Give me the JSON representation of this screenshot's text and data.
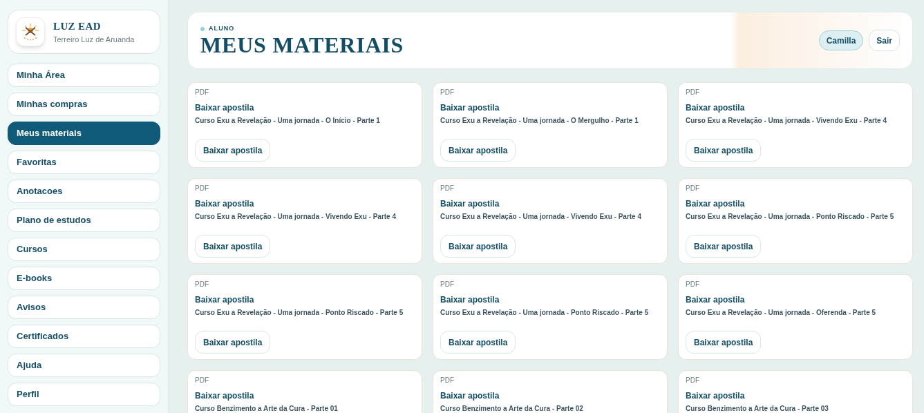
{
  "brand": {
    "title": "LUZ EAD",
    "subtitle": "Terreiro Luz de Aruanda"
  },
  "sidebar": {
    "items": [
      {
        "label": "Minha Área",
        "selected": false
      },
      {
        "label": "Minhas compras",
        "selected": false
      },
      {
        "label": "Meus materiais",
        "selected": true
      },
      {
        "label": "Favoritas",
        "selected": false
      },
      {
        "label": "Anotacoes",
        "selected": false
      },
      {
        "label": "Plano de estudos",
        "selected": false
      },
      {
        "label": "Cursos",
        "selected": false
      },
      {
        "label": "E-books",
        "selected": false
      },
      {
        "label": "Avisos",
        "selected": false
      },
      {
        "label": "Certificados",
        "selected": false
      },
      {
        "label": "Ajuda",
        "selected": false
      },
      {
        "label": "Perfil",
        "selected": false
      }
    ]
  },
  "header": {
    "eyebrow": "ALUNO",
    "title": "MEUS MATERIAIS",
    "user_button": "Camilla",
    "logout_button": "Sair"
  },
  "materials": [
    {
      "type": "PDF",
      "title": "Baixar apostila",
      "course": "Curso Exu a Revelação - Uma jornada - O Início - Parte 1",
      "button": "Baixar apostila"
    },
    {
      "type": "PDF",
      "title": "Baixar apostila",
      "course": "Curso Exu a Revelação - Uma jornada - O Mergulho - Parte 1",
      "button": "Baixar apostila"
    },
    {
      "type": "PDF",
      "title": "Baixar apostila",
      "course": "Curso Exu a Revelação - Uma jornada - Vivendo Exu - Parte 4",
      "button": "Baixar apostila"
    },
    {
      "type": "PDF",
      "title": "Baixar apostila",
      "course": "Curso Exu a Revelação - Uma jornada - Vivendo Exu - Parte 4",
      "button": "Baixar apostila"
    },
    {
      "type": "PDF",
      "title": "Baixar apostila",
      "course": "Curso Exu a Revelação - Uma jornada - Vivendo Exu - Parte 4",
      "button": "Baixar apostila"
    },
    {
      "type": "PDF",
      "title": "Baixar apostila",
      "course": "Curso Exu a Revelação - Uma jornada - Ponto Riscado - Parte 5",
      "button": "Baixar apostila"
    },
    {
      "type": "PDF",
      "title": "Baixar apostila",
      "course": "Curso Exu a Revelação - Uma jornada - Ponto Riscado - Parte 5",
      "button": "Baixar apostila"
    },
    {
      "type": "PDF",
      "title": "Baixar apostila",
      "course": "Curso Exu a Revelação - Uma jornada - Ponto Riscado - Parte 5",
      "button": "Baixar apostila"
    },
    {
      "type": "PDF",
      "title": "Baixar apostila",
      "course": "Curso Exu a Revelação - Uma jornada - Oferenda - Parte 5",
      "button": "Baixar apostila"
    },
    {
      "type": "PDF",
      "title": "Baixar apostila",
      "course": "Curso Benzimento a Arte da Cura - Parte 01"
    },
    {
      "type": "PDF",
      "title": "Baixar apostila",
      "course": "Curso Benzimento a Arte da Cura - Parte 02"
    },
    {
      "type": "PDF",
      "title": "Baixar apostila",
      "course": "Curso Benzimento a Arte da Cura - Parte 03"
    }
  ]
}
